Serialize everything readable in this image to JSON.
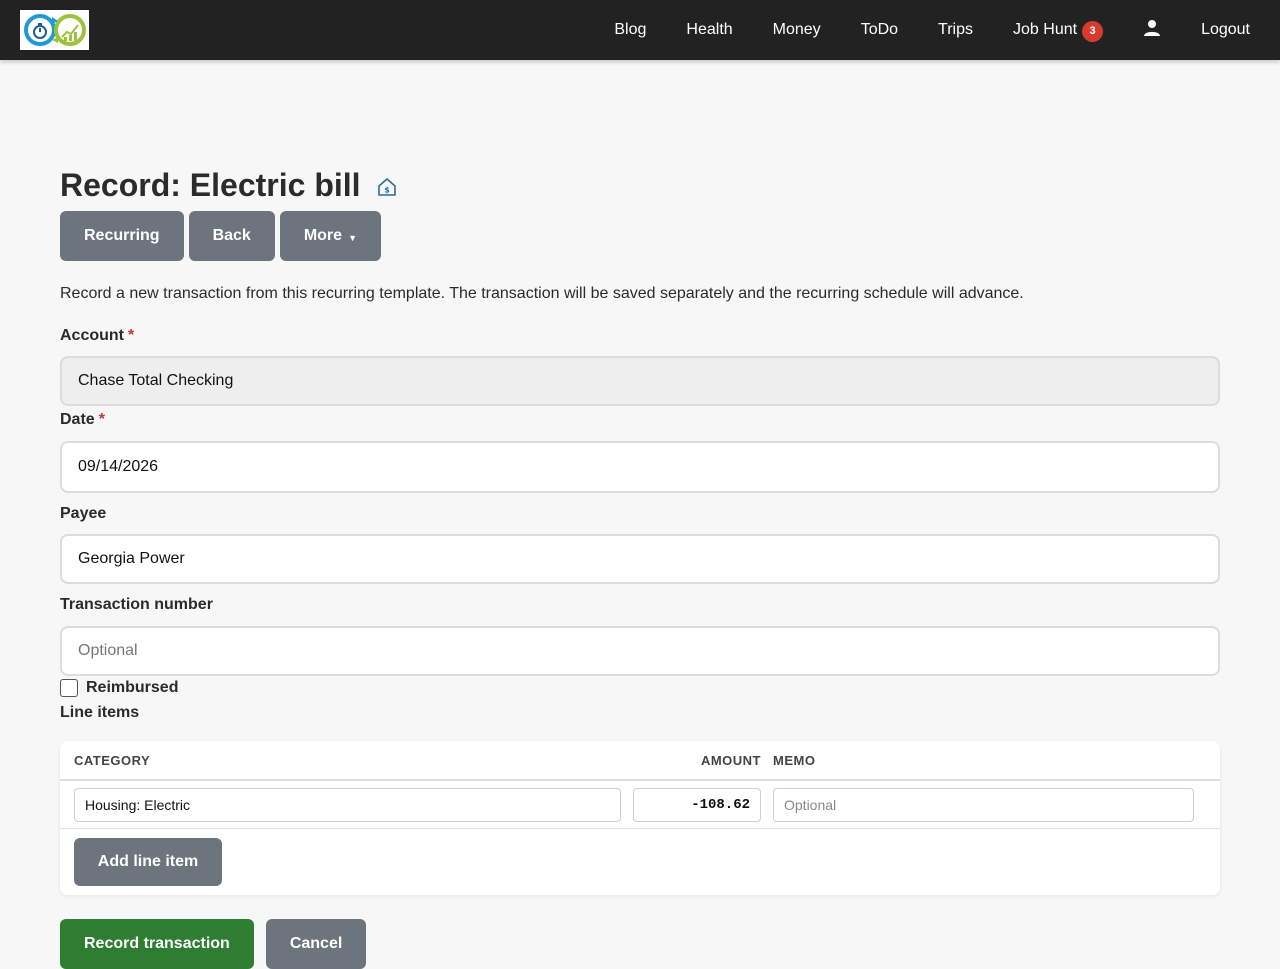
{
  "nav": {
    "items": [
      {
        "label": "Blog"
      },
      {
        "label": "Health"
      },
      {
        "label": "Money"
      },
      {
        "label": "ToDo"
      },
      {
        "label": "Trips"
      },
      {
        "label": "Job Hunt",
        "badge": "3"
      }
    ],
    "logout": "Logout"
  },
  "page": {
    "title": "Record: Electric bill",
    "icon": "house-dollar-icon",
    "buttons": {
      "recurring": "Recurring",
      "back": "Back",
      "more": "More"
    },
    "description": "Record a new transaction from this recurring template. The transaction will be saved separately and the recurring schedule will advance."
  },
  "form": {
    "account": {
      "label": "Account",
      "required_mark": "*",
      "value": "Chase Total Checking"
    },
    "date": {
      "label": "Date",
      "required_mark": "*",
      "value": "09/14/2026"
    },
    "payee": {
      "label": "Payee",
      "value": "Georgia Power"
    },
    "transaction_number": {
      "label": "Transaction number",
      "value": "",
      "placeholder": "Optional"
    },
    "reimbursed": {
      "label": "Reimbursed",
      "checked": false
    }
  },
  "line_items": {
    "label": "Line items",
    "headers": {
      "category": "CATEGORY",
      "amount": "AMOUNT",
      "memo": "MEMO"
    },
    "rows": [
      {
        "category": "Housing: Electric",
        "amount": "-108.62",
        "memo": "",
        "memo_placeholder": "Optional"
      }
    ],
    "add_button": "Add line item"
  },
  "actions": {
    "submit": "Record transaction",
    "cancel": "Cancel"
  },
  "colors": {
    "navbar": "#222222",
    "secondary_button": "#6c757d",
    "success_button": "#2e7d32",
    "badge": "#d93a2f",
    "required": "#c0392b"
  }
}
